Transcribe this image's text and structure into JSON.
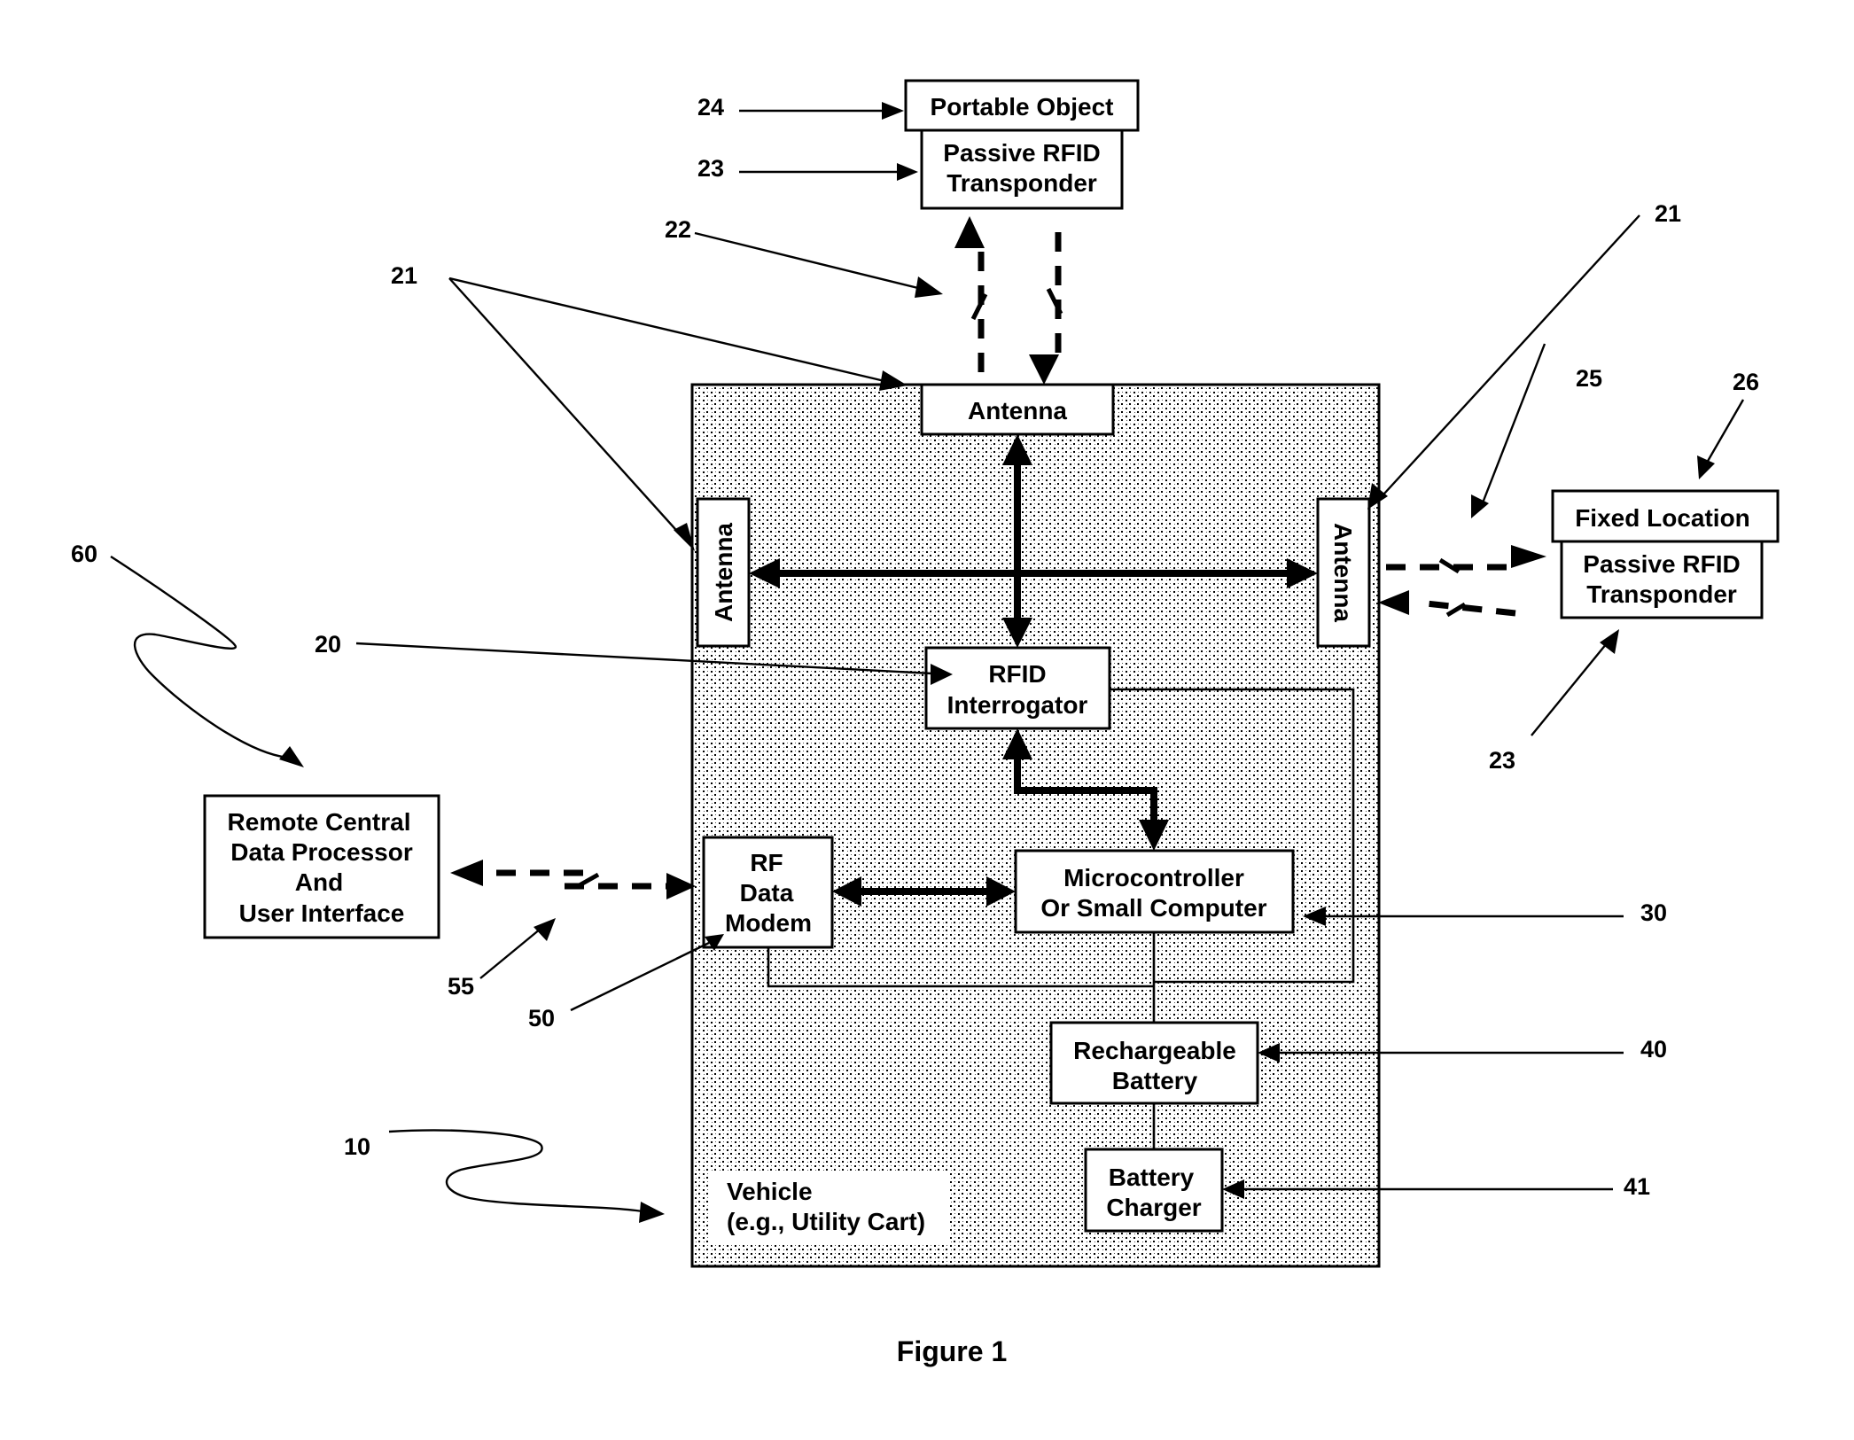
{
  "figure": {
    "caption": "Figure 1"
  },
  "colors": {
    "ink": "#000000",
    "background": "#ffffff",
    "vehicle_fill_pattern": "stippled gray"
  },
  "blocks": {
    "portable_object": {
      "label": "Portable Object",
      "ref": "24"
    },
    "passive_rfid_top": {
      "lines": [
        "Passive RFID",
        "Transponder"
      ],
      "ref": "23"
    },
    "antenna_top": {
      "label": "Antenna"
    },
    "antenna_left": {
      "label": "Antenna"
    },
    "antenna_right": {
      "label": "Antenna"
    },
    "rfid_interrogator": {
      "lines": [
        "RFID",
        "Interrogator"
      ],
      "ref": "20"
    },
    "microcontroller": {
      "lines": [
        "Microcontroller",
        "Or Small Computer"
      ],
      "ref": "30"
    },
    "rf_data_modem": {
      "lines": [
        "RF",
        "Data",
        "Modem"
      ],
      "ref": "50"
    },
    "rechargeable_battery": {
      "lines": [
        "Rechargeable",
        "Battery"
      ],
      "ref": "40"
    },
    "battery_charger": {
      "lines": [
        "Battery",
        "Charger"
      ],
      "ref": "41"
    },
    "remote_central": {
      "lines": [
        "Remote Central",
        "Data Processor",
        "And",
        "User Interface"
      ],
      "ref": "60"
    },
    "fixed_location": {
      "label": "Fixed Location",
      "ref": "26"
    },
    "passive_rfid_right": {
      "lines": [
        "Passive RFID",
        "Transponder"
      ],
      "ref": "23"
    },
    "vehicle": {
      "lines": [
        "Vehicle",
        "(e.g., Utility Cart)"
      ],
      "ref": "10"
    }
  },
  "refs": {
    "r24": "24",
    "r23_top": "23",
    "r22": "22",
    "r21_left": "21",
    "r21_right": "21",
    "r25": "25",
    "r26": "26",
    "r23_right": "23",
    "r20": "20",
    "r60": "60",
    "r55": "55",
    "r50": "50",
    "r30": "30",
    "r40": "40",
    "r41": "41",
    "r10": "10"
  }
}
